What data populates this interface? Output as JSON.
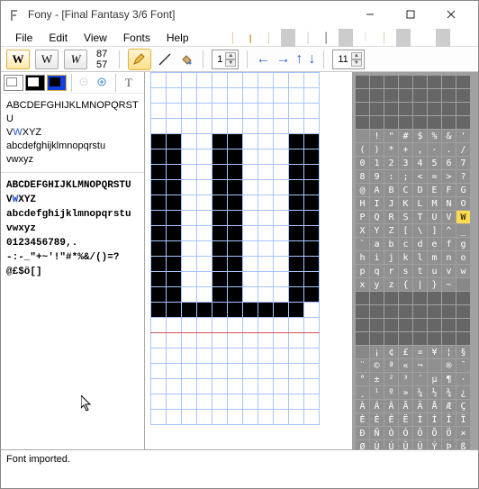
{
  "window": {
    "title": "Fony - [Final Fantasy 3/6 Font]"
  },
  "menu": {
    "file": "File",
    "edit": "Edit",
    "view": "View",
    "fonts": "Fonts",
    "help": "Help"
  },
  "metrics": {
    "top": "87",
    "bottom": "57"
  },
  "spin1": "1",
  "spin2": "11",
  "preview": {
    "upper": "ABCDEFGHIJKLMNOPQRSTU",
    "upper2a": "V",
    "upper2b": "W",
    "upper2c": "XYZ",
    "lower": "abcdefghijklmnopqrstu",
    "lower2": "vwxyz"
  },
  "preview2": {
    "l1": "ABCDEFGHIJKLMNOPQRSTU",
    "l2a": "V",
    "l2b": "W",
    "l2c": "XYZ",
    "l3": "abcdefghijklmnopqrstu",
    "l4": "vwxyz",
    "l5": "0123456789,.",
    "l6": "-:-_\"+~'!\"#*%&/()=?",
    "l7": "@£$ö[]"
  },
  "glyph_rows": [
    [
      "",
      "",
      "",
      "",
      "",
      "",
      "",
      ""
    ],
    [
      "",
      "",
      "",
      "",
      "",
      "",
      "",
      ""
    ],
    [
      "",
      "",
      "",
      "",
      "",
      "",
      "",
      ""
    ],
    [
      "",
      "",
      "",
      "",
      "",
      "",
      "",
      ""
    ],
    [
      " ",
      "!",
      "\"",
      "#",
      "$",
      "%",
      "&",
      "'"
    ],
    [
      "(",
      ")",
      "*",
      "+",
      ",",
      "-",
      ".",
      "/"
    ],
    [
      "0",
      "1",
      "2",
      "3",
      "4",
      "5",
      "6",
      "7"
    ],
    [
      "8",
      "9",
      ":",
      ";",
      "<",
      "=",
      ">",
      "?"
    ],
    [
      "@",
      "A",
      "B",
      "C",
      "D",
      "E",
      "F",
      "G"
    ],
    [
      "H",
      "I",
      "J",
      "K",
      "L",
      "M",
      "N",
      "O"
    ],
    [
      "P",
      "Q",
      "R",
      "S",
      "T",
      "U",
      "V",
      "W"
    ],
    [
      "X",
      "Y",
      "Z",
      "[",
      "\\",
      "]",
      "^",
      "_"
    ],
    [
      "`",
      "a",
      "b",
      "c",
      "d",
      "e",
      "f",
      "g"
    ],
    [
      "h",
      "i",
      "j",
      "k",
      "l",
      "m",
      "n",
      "o"
    ],
    [
      "p",
      "q",
      "r",
      "s",
      "t",
      "u",
      "v",
      "w"
    ],
    [
      "x",
      "y",
      "z",
      "{",
      "|",
      "}",
      "~",
      ""
    ],
    [
      "",
      "",
      "",
      "",
      "",
      "",
      "",
      ""
    ],
    [
      "",
      "",
      "",
      "",
      "",
      "",
      "",
      ""
    ],
    [
      "",
      "",
      "",
      "",
      "",
      "",
      "",
      ""
    ],
    [
      "",
      "",
      "",
      "",
      "",
      "",
      "",
      ""
    ],
    [
      "",
      "¡",
      "¢",
      "£",
      "¤",
      "¥",
      "¦",
      "§"
    ],
    [
      "¨",
      "©",
      "ª",
      "«",
      "¬",
      "­",
      "®",
      "¯"
    ],
    [
      "°",
      "±",
      "²",
      "³",
      "´",
      "µ",
      "¶",
      "·"
    ],
    [
      "¸",
      "¹",
      "º",
      "»",
      "¼",
      "½",
      "¾",
      "¿"
    ],
    [
      "À",
      "Á",
      "Â",
      "Ã",
      "Ä",
      "Å",
      "Æ",
      "Ç"
    ],
    [
      "È",
      "É",
      "Ê",
      "Ë",
      "Ì",
      "Í",
      "Î",
      "Ï"
    ],
    [
      "Ð",
      "Ñ",
      "Ò",
      "Ó",
      "Ô",
      "Õ",
      "Ö",
      "×"
    ],
    [
      "Ø",
      "Ù",
      "Ú",
      "Û",
      "Ü",
      "Ý",
      "Þ",
      "ß"
    ]
  ],
  "selected_glyph": {
    "row": 10,
    "col": 7
  },
  "status": "Font imported.",
  "editor_pixels": {
    "rows": 23,
    "cols": 11,
    "cells": [
      "00000000000",
      "00000000000",
      "00000000000",
      "00000000000",
      "11001100011",
      "11001100011",
      "11001100011",
      "11001100011",
      "11001100011",
      "11001100011",
      "11001100011",
      "11001100011",
      "11001100011",
      "11001100011",
      "11001100011",
      "11111111110",
      "00000000000",
      "00000000000",
      "00000000000",
      "00000000000",
      "00000000000",
      "00000000000",
      "00000000000"
    ],
    "baseline_row": 16
  }
}
